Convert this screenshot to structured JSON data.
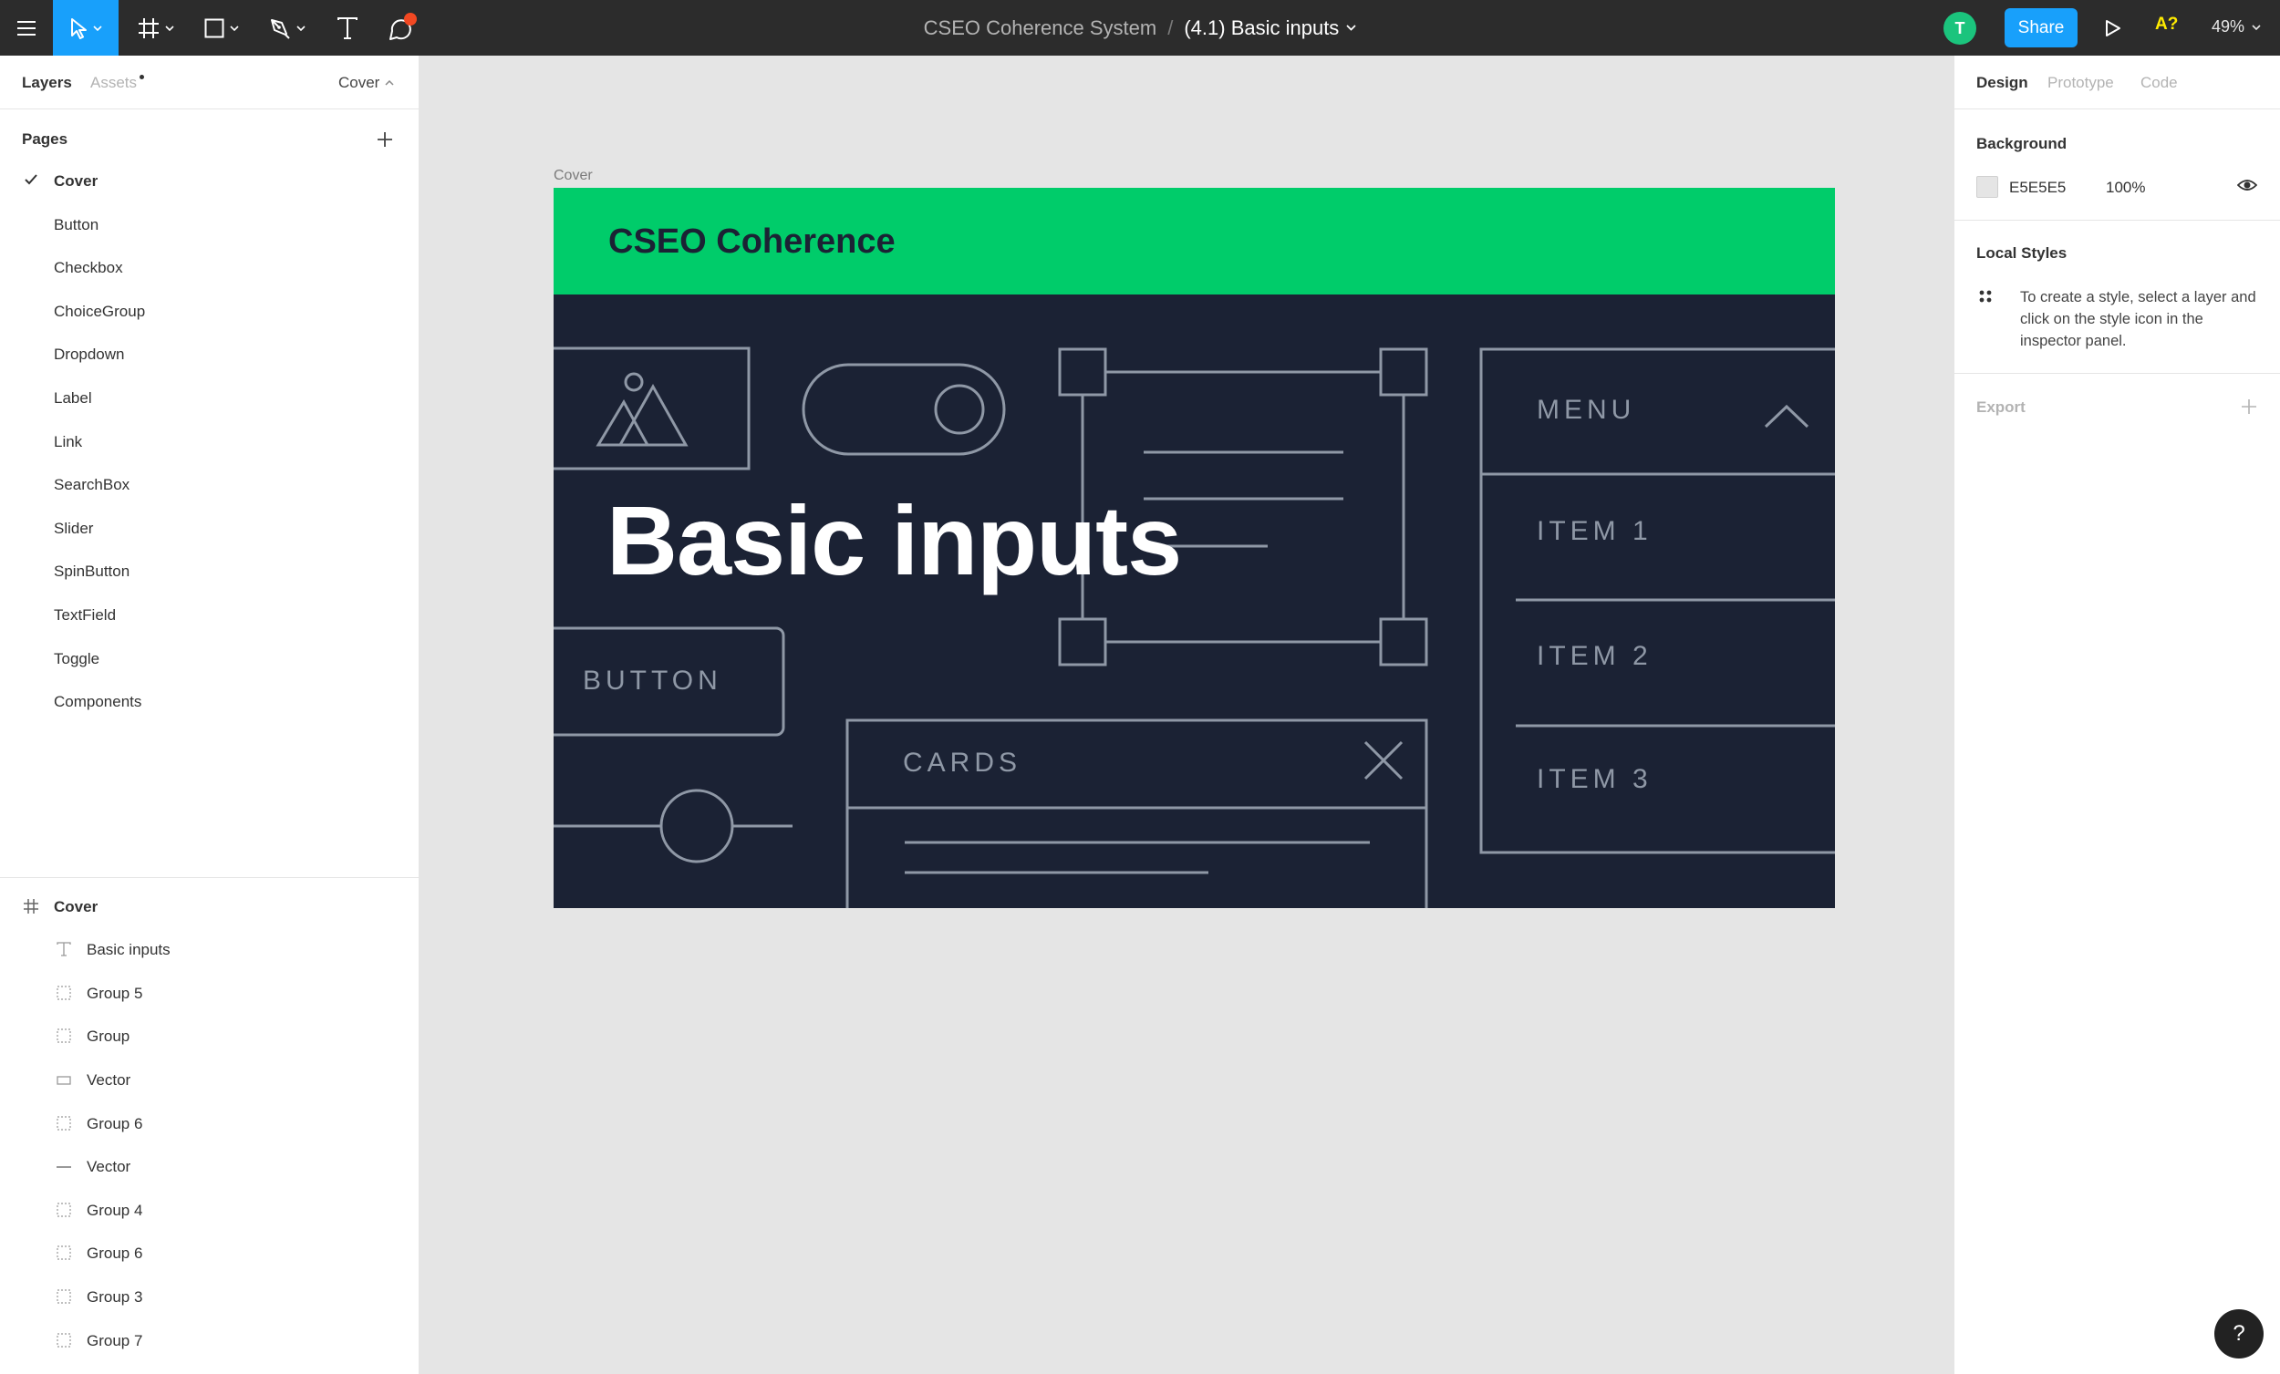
{
  "toolbar": {
    "project": "CSEO Coherence System",
    "separator": "/",
    "file": "(4.1) Basic inputs",
    "avatar_initial": "T",
    "share": "Share",
    "font_warning": "A?",
    "zoom": "49%",
    "icons": [
      "menu-icon",
      "move-tool-icon",
      "frame-tool-icon",
      "rectangle-tool-icon",
      "pen-tool-icon",
      "text-tool-icon",
      "comment-tool-icon",
      "play-icon"
    ]
  },
  "left_panel": {
    "tab_layers": "Layers",
    "tab_assets": "Assets",
    "page_dropdown": "Cover",
    "pages_title": "Pages",
    "pages": [
      {
        "label": "Cover",
        "current": true
      },
      {
        "label": "Button"
      },
      {
        "label": "Checkbox"
      },
      {
        "label": "ChoiceGroup"
      },
      {
        "label": "Dropdown"
      },
      {
        "label": "Label"
      },
      {
        "label": "Link"
      },
      {
        "label": "SearchBox"
      },
      {
        "label": "Slider"
      },
      {
        "label": "SpinButton"
      },
      {
        "label": "TextField"
      },
      {
        "label": "Toggle"
      },
      {
        "label": "Components"
      }
    ],
    "layers": [
      {
        "label": "Cover",
        "icon": "frame-icon"
      },
      {
        "label": "Basic inputs",
        "icon": "text-icon"
      },
      {
        "label": "Group 5",
        "icon": "group-icon"
      },
      {
        "label": "Group",
        "icon": "group-icon"
      },
      {
        "label": "Vector",
        "icon": "rectangle-icon"
      },
      {
        "label": "Group 6",
        "icon": "group-icon"
      },
      {
        "label": "Vector",
        "icon": "line-icon"
      },
      {
        "label": "Group 4",
        "icon": "group-icon"
      },
      {
        "label": "Group 6",
        "icon": "group-icon"
      },
      {
        "label": "Group 3",
        "icon": "group-icon"
      },
      {
        "label": "Group 7",
        "icon": "group-icon"
      }
    ]
  },
  "canvas": {
    "frame_label": "Cover",
    "brand": "CSEO Coherence",
    "title": "Basic inputs",
    "wire_button": "BUTTON",
    "wire_cards": "CARDS",
    "wire_menu": "MENU",
    "wire_item1": "ITEM 1",
    "wire_item2": "ITEM 2",
    "wire_item3": "ITEM 3",
    "colors": {
      "header": "#00cc6a",
      "body": "#1b2234",
      "wire": "#8f98a6",
      "canvas_bg": "#e5e5e5"
    }
  },
  "right_panel": {
    "tab_design": "Design",
    "tab_prototype": "Prototype",
    "tab_code": "Code",
    "background_title": "Background",
    "bg_hex": "E5E5E5",
    "bg_opacity": "100%",
    "local_styles_title": "Local Styles",
    "local_styles_help": "To create a style, select a layer and click on the style icon in the inspector panel.",
    "export_title": "Export"
  },
  "help": "?"
}
